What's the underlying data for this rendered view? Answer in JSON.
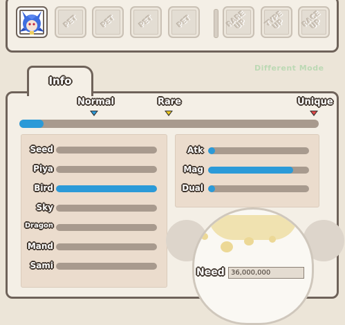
{
  "slots": [
    {
      "label": "",
      "active": true
    },
    {
      "label": "PET",
      "active": false
    },
    {
      "label": "PET",
      "active": false
    },
    {
      "label": "PET",
      "active": false
    },
    {
      "label": "PET",
      "active": false
    }
  ],
  "upgrade_slots": [
    {
      "label": "RARE UP"
    },
    {
      "label": "TYPE UP"
    },
    {
      "label": "RACE UP"
    }
  ],
  "background_text": "Different Mode",
  "tab": {
    "label": "Info"
  },
  "rarity": {
    "labels": [
      {
        "text": "Normal",
        "color": "#2b9ad8"
      },
      {
        "text": "Rare",
        "color": "#e8c420"
      },
      {
        "text": "Unique",
        "color": "#e04848"
      }
    ],
    "progress": 0.08
  },
  "types": [
    {
      "label": "Seed",
      "value": 0.0
    },
    {
      "label": "Piya",
      "value": 0.0
    },
    {
      "label": "Bird",
      "value": 1.0
    },
    {
      "label": "Sky",
      "value": 0.0
    },
    {
      "label": "Dragon",
      "value": 0.0
    },
    {
      "label": "Mand",
      "value": 0.0
    },
    {
      "label": "Sami",
      "value": 0.0
    }
  ],
  "attributes": [
    {
      "label": "Atk",
      "value": 0.07
    },
    {
      "label": "Mag",
      "value": 0.84
    },
    {
      "label": "Dual",
      "value": 0.07
    }
  ],
  "need": {
    "label": "Need",
    "value": "36,000,000"
  },
  "colors": {
    "accent": "#2b9ad8",
    "border": "#6e6259",
    "panel": "#f4efe6"
  }
}
